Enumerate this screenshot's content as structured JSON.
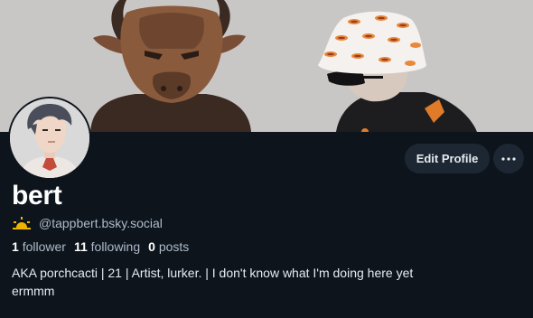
{
  "profile": {
    "display_name": "bert",
    "handle": "@tappbert.bsky.social",
    "followers_count": "1",
    "followers_label": "follower",
    "following_count": "11",
    "following_label": "following",
    "posts_count": "0",
    "posts_label": "posts",
    "bio_line1": "AKA porchcacti | 21 | Artist, lurker. | I don't know what I'm doing here yet",
    "bio_line2": "ermmm"
  },
  "actions": {
    "edit_profile_label": "Edit Profile",
    "more_icon": "more-horizontal-icon"
  },
  "icons": {
    "handle_badge": "sunrise-icon"
  },
  "colors": {
    "background": "#0d141c",
    "button_bg": "#1d2733",
    "text_primary": "#ffffff",
    "text_secondary": "#aebbc9",
    "badge_accent": "#f0b400"
  }
}
